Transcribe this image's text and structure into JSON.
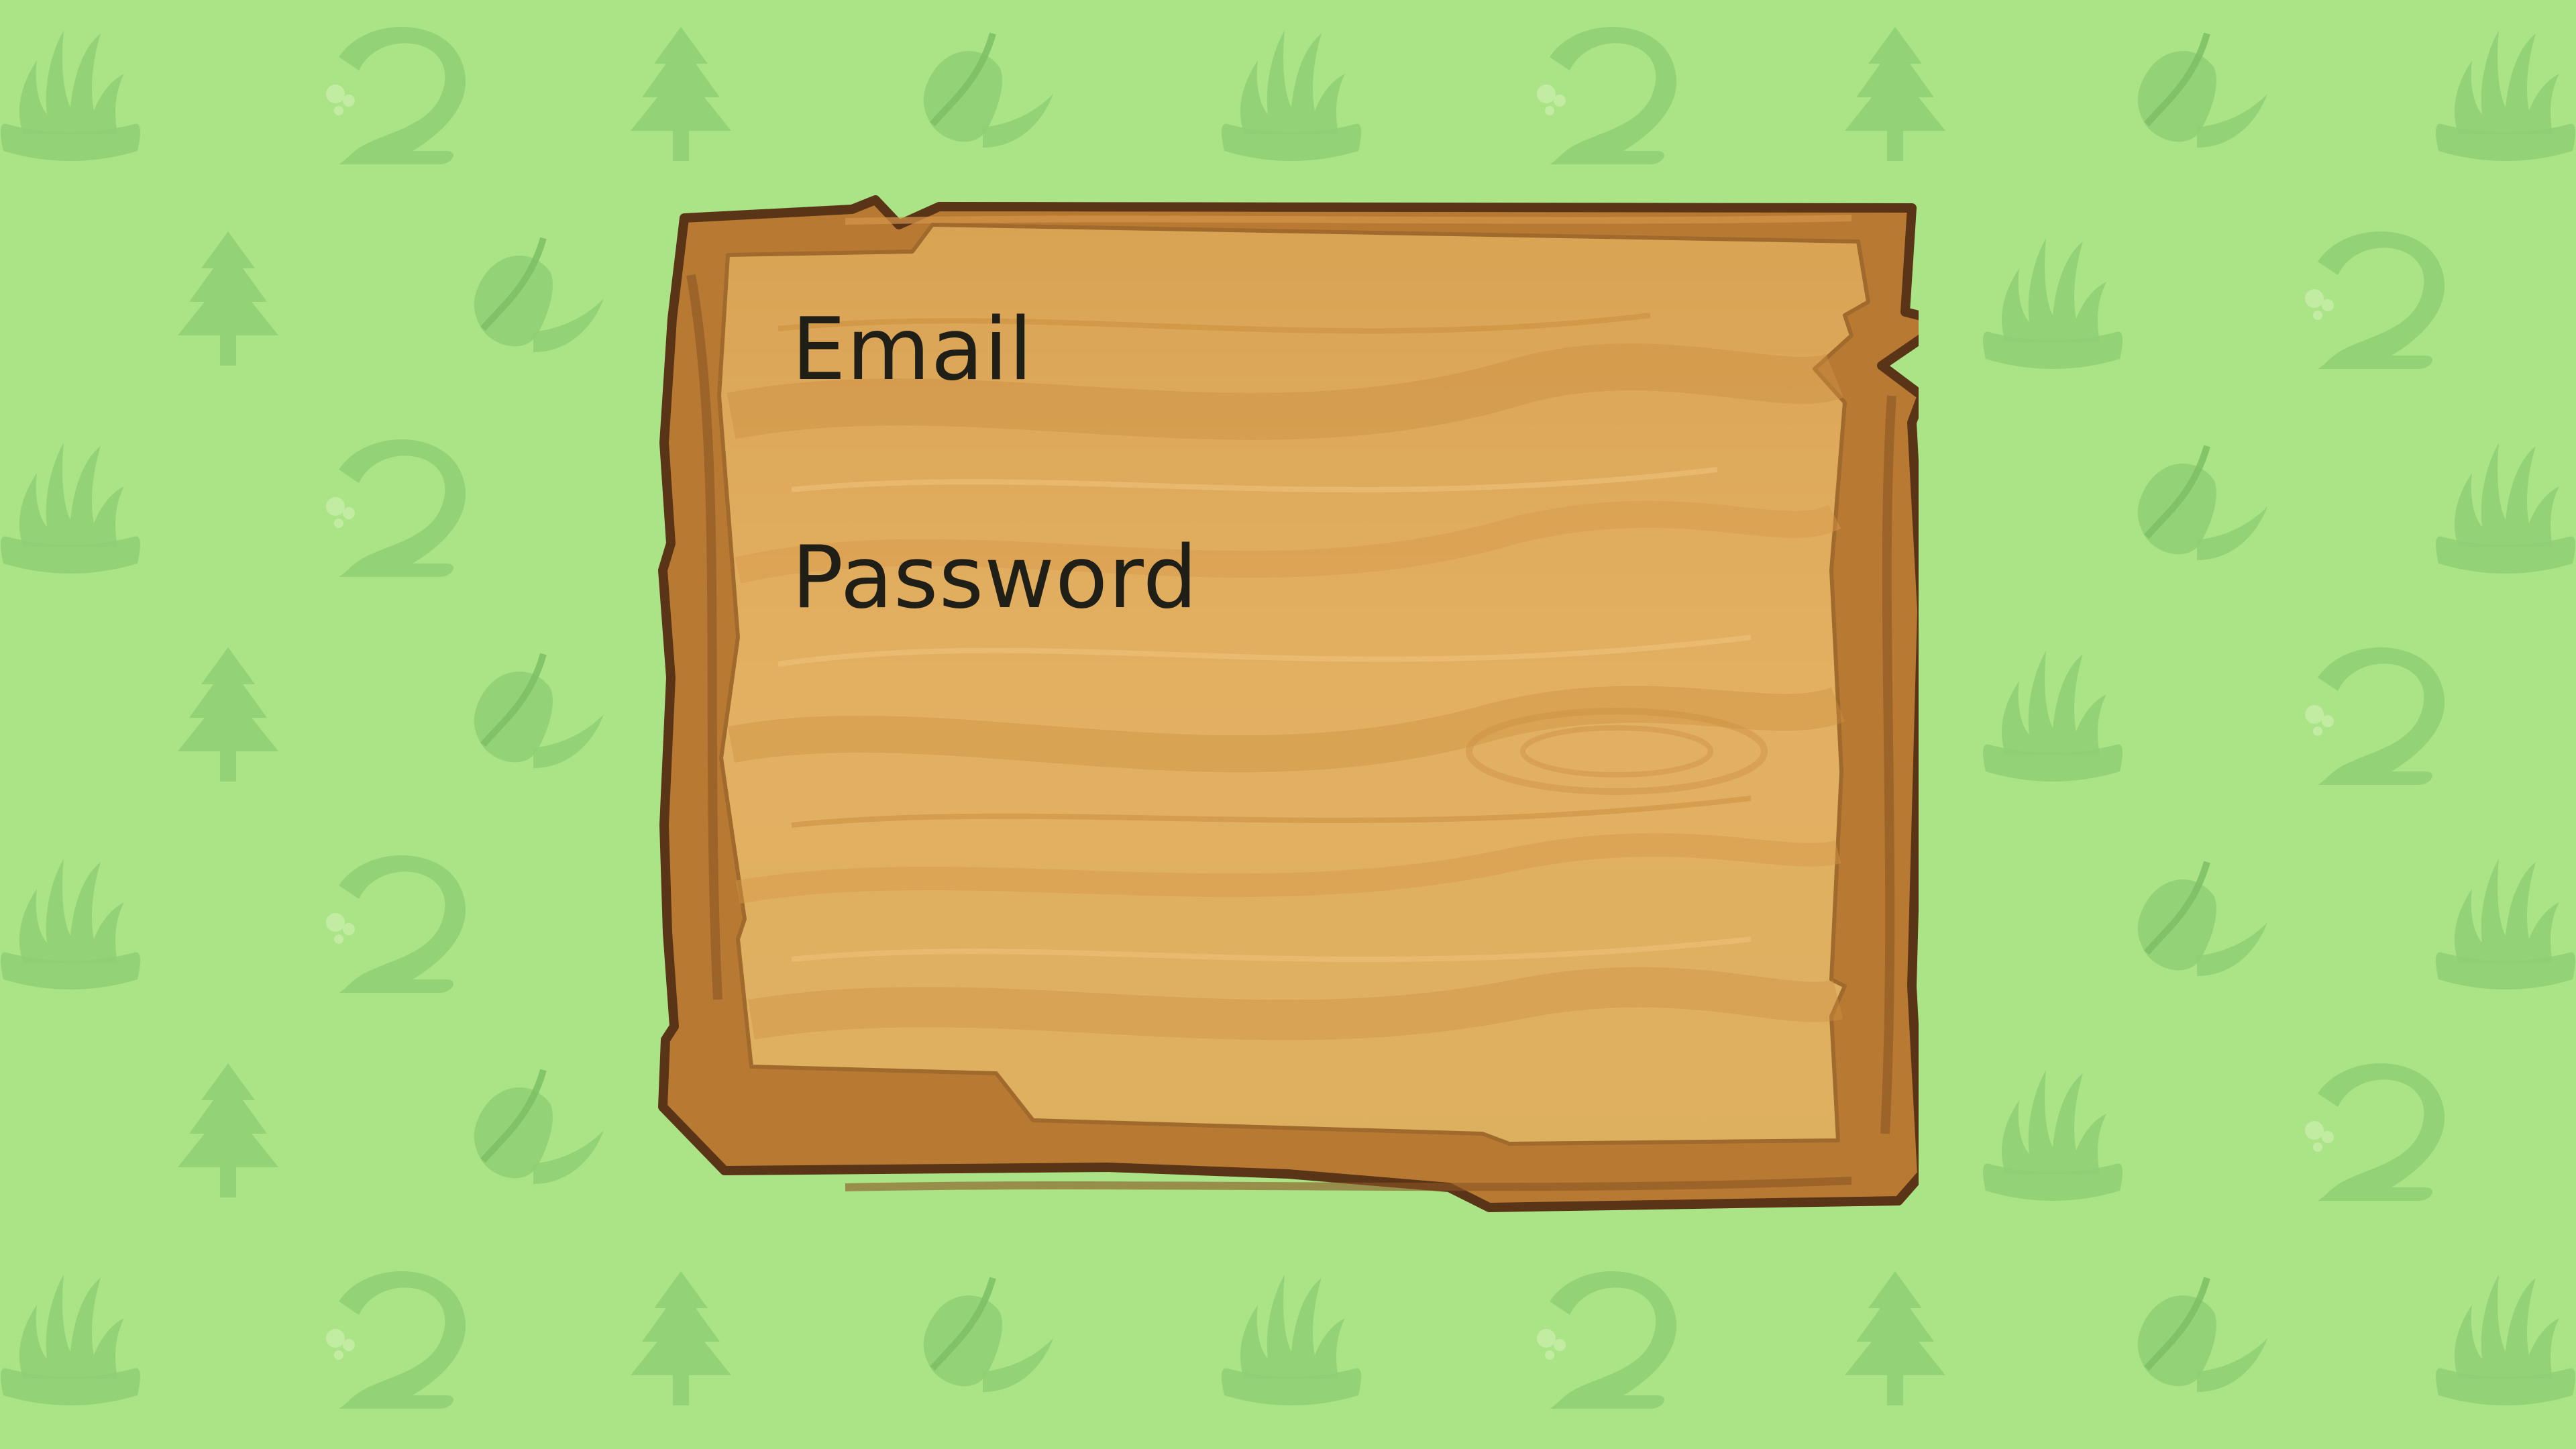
{
  "login_board": {
    "email_label": "Email",
    "password_label": "Password"
  },
  "background": {
    "color": "#abe387",
    "icons": [
      "grass-tuft-icon",
      "water-swirl-icon",
      "pine-tree-icon",
      "leaf-icon"
    ]
  },
  "colors": {
    "board_light": "#e2ad5c",
    "board_mid": "#cf9447",
    "board_frame": "#b87a33",
    "board_outline": "#5a3417",
    "label_text": "#1f1e17"
  }
}
